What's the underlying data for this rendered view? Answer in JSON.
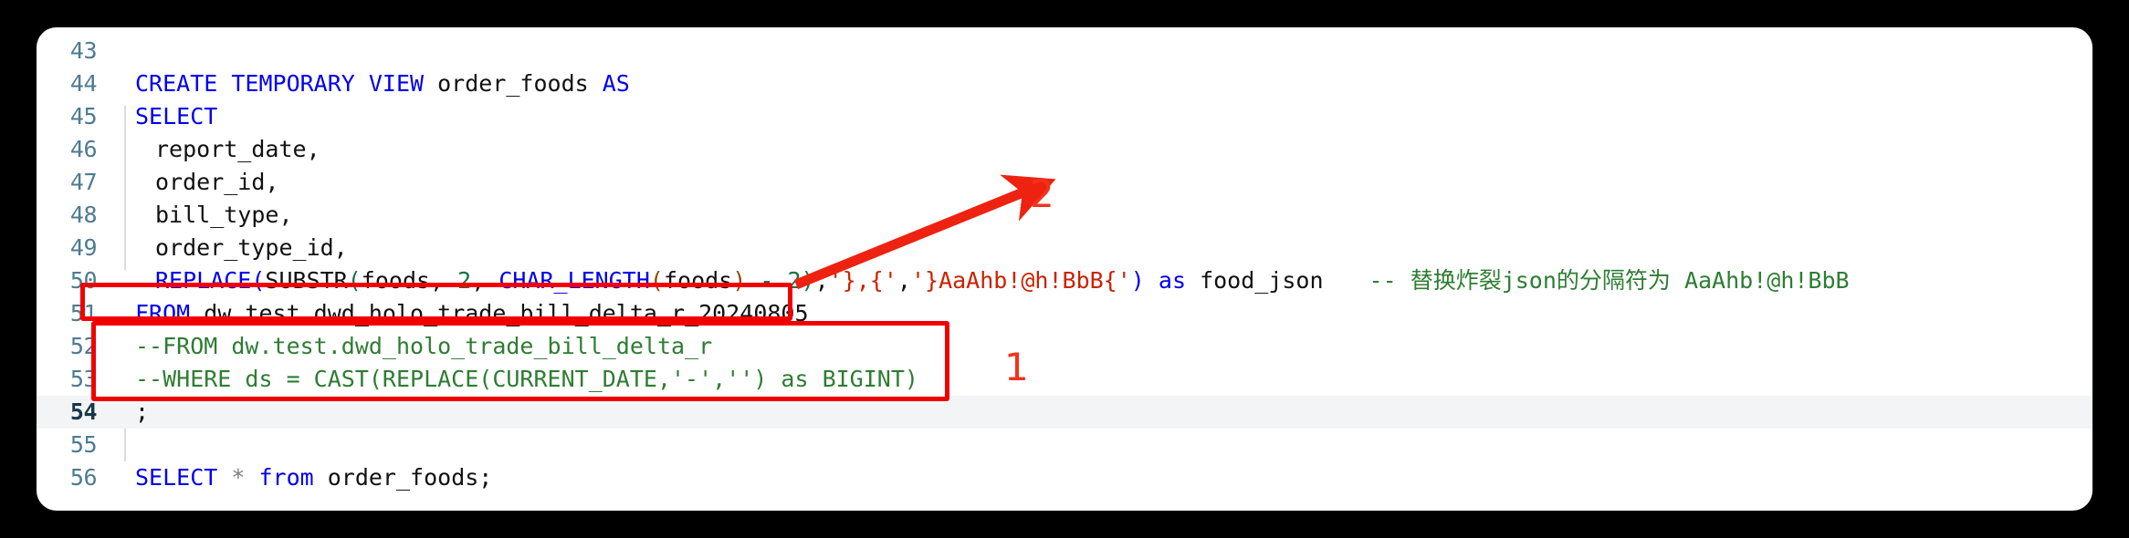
{
  "editor": {
    "language": "sql",
    "current_line": 54,
    "gutter_color": "#4d7b93",
    "background": "#ffffff",
    "lines": [
      {
        "number": "43",
        "text": ""
      },
      {
        "number": "44",
        "text": "CREATE TEMPORARY VIEW order_foods AS"
      },
      {
        "number": "45",
        "text": "SELECT"
      },
      {
        "number": "46",
        "text": "  report_date,"
      },
      {
        "number": "47",
        "text": "  order_id,"
      },
      {
        "number": "48",
        "text": "  bill_type,"
      },
      {
        "number": "49",
        "text": "  order_type_id,"
      },
      {
        "number": "50",
        "text": "  REPLACE(SUBSTR(foods, 2, CHAR_LENGTH(foods) - 2),'},{','}AaAhb!@h!BbB{') as food_json    -- 替换炸裂json的分隔符为 AaAhb!@h!BbB"
      },
      {
        "number": "51",
        "text": "FROM dw.test.dwd_holo_trade_bill_delta_r_20240805"
      },
      {
        "number": "52",
        "text": "--FROM dw.test.dwd_holo_trade_bill_delta_r"
      },
      {
        "number": "53",
        "text": "--WHERE ds = CAST(REPLACE(CURRENT_DATE,'-','') as BIGINT)"
      },
      {
        "number": "54",
        "text": ";"
      },
      {
        "number": "55",
        "text": ""
      },
      {
        "number": "56",
        "text": "SELECT * from order_foods;"
      }
    ],
    "tokens": {
      "line44": {
        "kw1": "CREATE TEMPORARY VIEW",
        "ident": " order_foods ",
        "kw2": "AS"
      },
      "line45": {
        "kw": "SELECT"
      },
      "line46": {
        "ident": "report_date,"
      },
      "line47": {
        "ident": "order_id,"
      },
      "line48": {
        "ident": "bill_type,"
      },
      "line49": {
        "ident": "order_type_id,"
      },
      "line50": {
        "fn_replace": "REPLACE",
        "paren_open1": "(",
        "fn_substr": "SUBSTR",
        "paren_open2": "(",
        "arg_foods1": "foods, ",
        "num_2a": "2",
        "comma1": ", ",
        "fn_charlength": "CHAR_LENGTH",
        "paren_open3": "(",
        "arg_foods2": "foods",
        "paren_close3": ")",
        "minus": " - ",
        "num_2b": "2",
        "paren_close2": ")",
        "comma2": ",",
        "str_a": "'},{'",
        "comma3": ",",
        "str_b": "'}AaAhb!@h!BbB{'",
        "paren_close1": ")",
        "kw_as": " as ",
        "alias": "food_json",
        "comment": "-- 替换炸裂json的分隔符为 AaAhb!@h!BbB"
      },
      "line51": {
        "kw_from": "FROM",
        "table": " dw.test.dwd_holo_trade_bill_delta_r_20240805"
      },
      "line52": {
        "comment": "--FROM dw.test.dwd_holo_trade_bill_delta_r"
      },
      "line53": {
        "comment": "--WHERE ds = CAST(REPLACE(CURRENT_DATE,'-','') as BIGINT)"
      },
      "line54": {
        "semicolon": ";"
      },
      "line56": {
        "kw_select": "SELECT",
        "star": " * ",
        "kw_from": "from",
        "ident": " order_foods;"
      }
    }
  },
  "annotations": {
    "color": "#f1331b",
    "box_color": "#f10000",
    "marker_1": "1",
    "marker_2": "2",
    "arrow": "red-arrow-up-right",
    "box_from_label": "highlight-box-active-from-clause",
    "box_commented_label": "highlight-box-commented-from-where"
  }
}
